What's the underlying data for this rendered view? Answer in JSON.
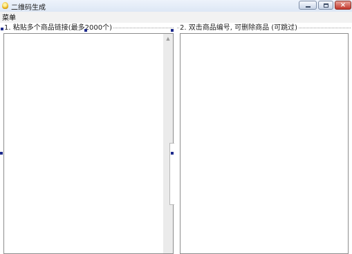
{
  "window": {
    "title": "二维码生成",
    "icon": "app-icon",
    "controls": [
      "minimize-icon",
      "maximize-icon",
      "close-icon"
    ],
    "close_glyph": "×"
  },
  "menu": {
    "items": [
      "菜单"
    ]
  },
  "panels": {
    "left": {
      "label": "1. 粘贴多个商品链接(最多2000个)",
      "items": []
    },
    "right": {
      "label": "2. 双击商品编号, 可删除商品 (可跳过)",
      "items": []
    }
  },
  "scrollbar": {
    "up_glyph": "▲"
  },
  "colors": {
    "selection_handle": "#1d2a8c",
    "close_button": "#c2362b"
  }
}
